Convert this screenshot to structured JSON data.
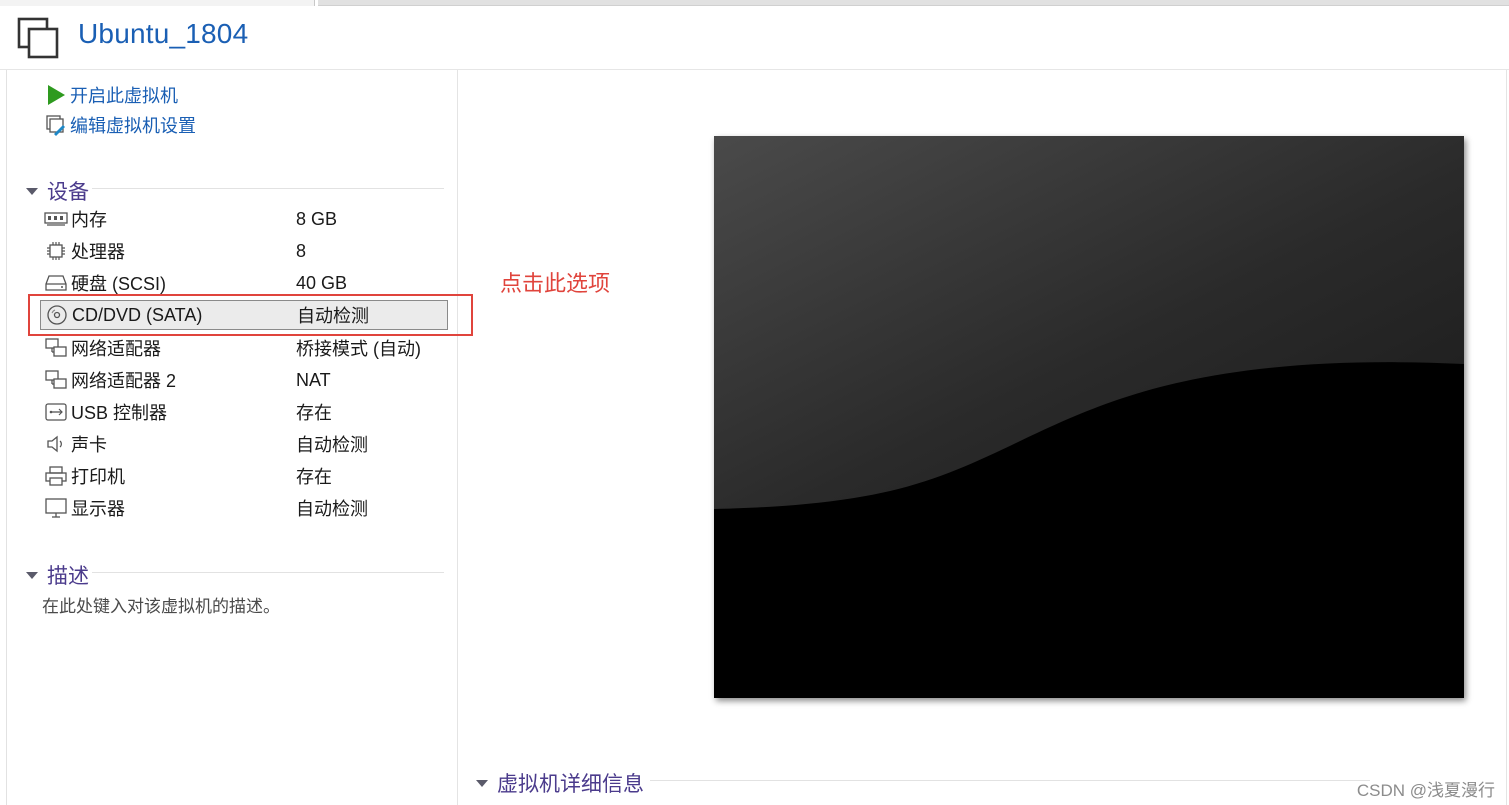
{
  "vm": {
    "title": "Ubuntu_1804"
  },
  "actions": [
    {
      "label": "开启此虚拟机",
      "icon": "play-icon"
    },
    {
      "label": "编辑虚拟机设置",
      "icon": "edit-settings-icon"
    }
  ],
  "devices_section": {
    "title": "设备"
  },
  "devices": [
    {
      "name": "内存",
      "value": "8 GB",
      "icon": "memory-icon"
    },
    {
      "name": "处理器",
      "value": "8",
      "icon": "cpu-icon"
    },
    {
      "name": "硬盘 (SCSI)",
      "value": "40 GB",
      "icon": "hard-disk-icon"
    },
    {
      "name": "CD/DVD (SATA)",
      "value": "自动检测",
      "icon": "cd-dvd-icon",
      "selected": true
    },
    {
      "name": "网络适配器",
      "value": "桥接模式 (自动)",
      "icon": "network-adapter-icon"
    },
    {
      "name": "网络适配器 2",
      "value": "NAT",
      "icon": "network-adapter-icon"
    },
    {
      "name": "USB 控制器",
      "value": "存在",
      "icon": "usb-icon"
    },
    {
      "name": "声卡",
      "value": "自动检测",
      "icon": "speaker-icon"
    },
    {
      "name": "打印机",
      "value": "存在",
      "icon": "printer-icon"
    },
    {
      "name": "显示器",
      "value": "自动检测",
      "icon": "monitor-icon"
    }
  ],
  "annotation": {
    "text": "点击此选项",
    "color": "#e0443c"
  },
  "description_section": {
    "title": "描述",
    "placeholder": "在此处键入对该虚拟机的描述。"
  },
  "details_section": {
    "title": "虚拟机详细信息"
  },
  "watermark": "CSDN @浅夏漫行",
  "colors": {
    "link": "#1a5fb4",
    "section": "#4b3b8c",
    "accent_red": "#e0443c",
    "play_green": "#2e9a1f"
  }
}
